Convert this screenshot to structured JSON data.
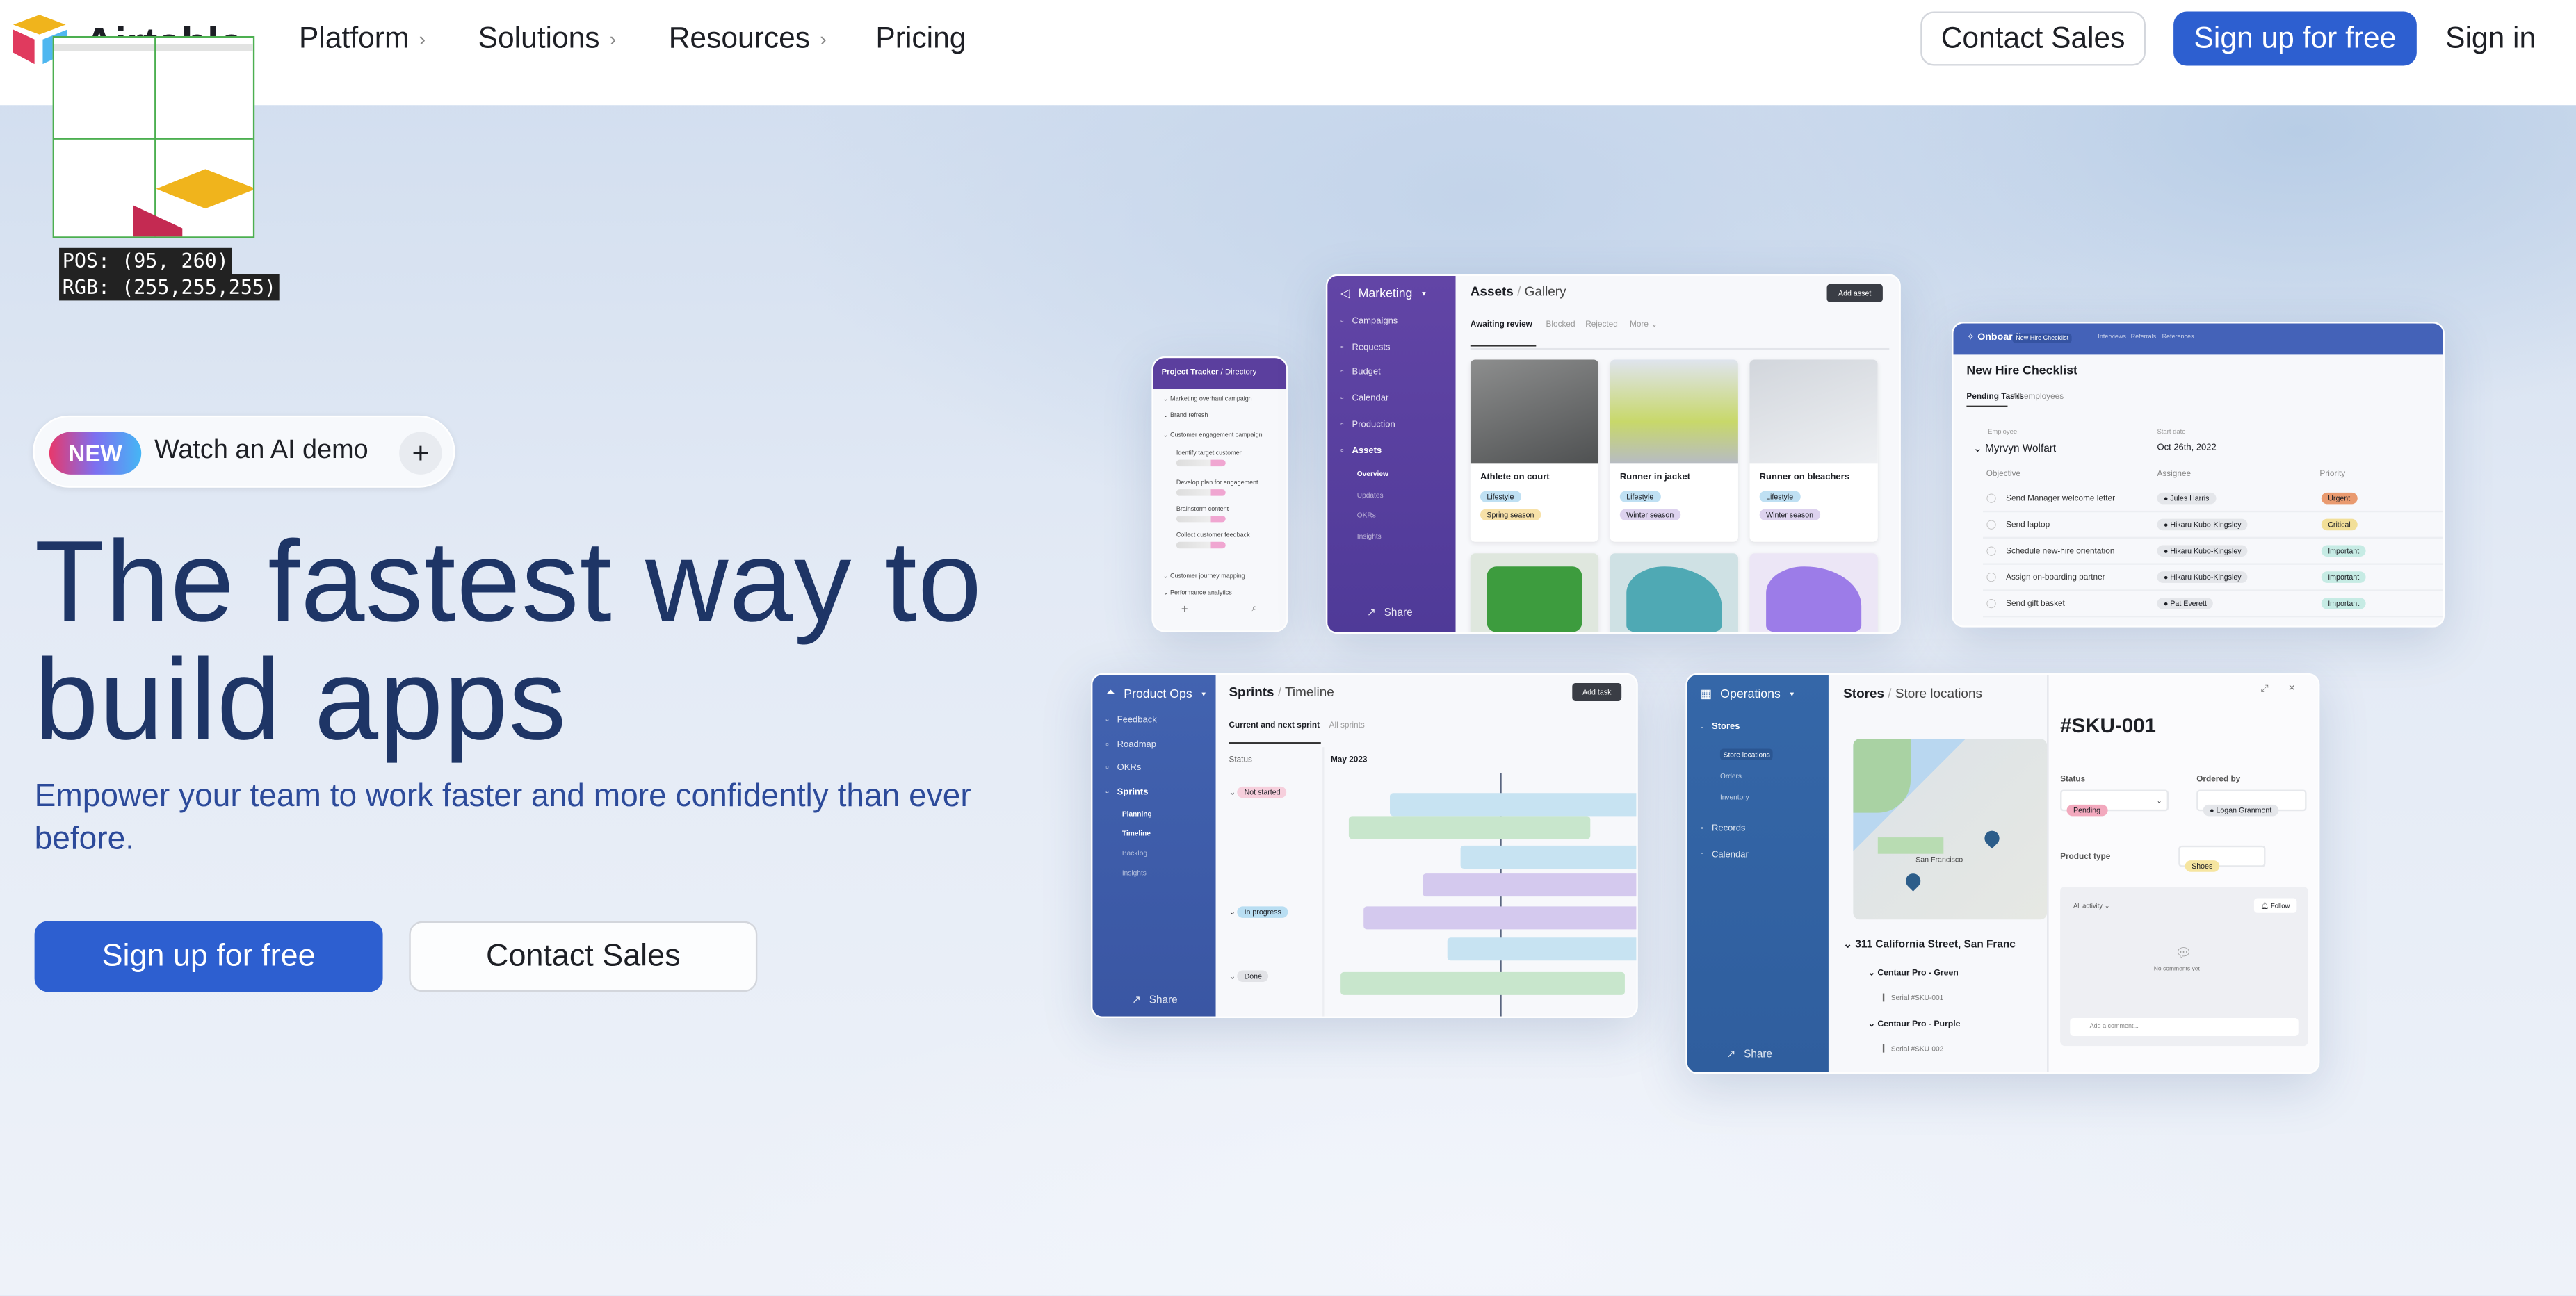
{
  "nav": {
    "brand": "Airtable",
    "items": [
      {
        "label": "Platform",
        "chevron": true
      },
      {
        "label": "Solutions",
        "chevron": true
      },
      {
        "label": "Resources",
        "chevron": true
      },
      {
        "label": "Pricing",
        "chevron": false
      }
    ],
    "contact_sales": "Contact Sales",
    "sign_up": "Sign up for free",
    "sign_in": "Sign in"
  },
  "overlay": {
    "pos": "POS: (95, 260)",
    "rgb": "RGB: (255,255,255)"
  },
  "hero": {
    "badge": "NEW",
    "demo": "Watch an AI demo",
    "title_line1": "The fastest way to",
    "title_line2": "build apps",
    "subtitle": "Empower your team to work faster and more confidently than ever before.",
    "cta_primary": "Sign up for free",
    "cta_secondary": "Contact Sales"
  },
  "colors": {
    "primary": "#2d5fd0",
    "heading": "#1e3566",
    "marketing": "#5b3f9e",
    "product_ops": "#3c5aa8",
    "operations": "#2f62a0",
    "onboarding": "#4462b8"
  },
  "tracker": {
    "title": "Project Tracker",
    "subtitle": "Directory",
    "items": [
      "Marketing overhaul campaign",
      "Brand refresh",
      "Customer engagement campaign",
      "Identify target customer",
      "Develop plan for engagement",
      "Brainstorm content",
      "Collect customer feedback",
      "Customer journey mapping",
      "Performance analytics"
    ]
  },
  "marketing": {
    "workspace": "Marketing",
    "nav": [
      "Campaigns",
      "Requests",
      "Budget",
      "Calendar",
      "Production",
      "Assets"
    ],
    "sub": [
      "Overview",
      "Updates",
      "OKRs",
      "Insights"
    ],
    "share": "Share",
    "title": "Assets",
    "view": "Gallery",
    "add": "Add asset",
    "tabs": [
      "Awaiting review",
      "Blocked",
      "Rejected",
      "More"
    ],
    "cards": [
      {
        "name": "Athlete on court",
        "tags": [
          "Lifestyle",
          "Spring season"
        ]
      },
      {
        "name": "Runner in jacket",
        "tags": [
          "Lifestyle",
          "Winter season"
        ]
      },
      {
        "name": "Runner on bleachers",
        "tags": [
          "Lifestyle",
          "Winter season"
        ]
      }
    ]
  },
  "onboarding": {
    "workspace": "Onboarding",
    "tabs": [
      "New Hire Checklist",
      "Interviews",
      "Referrals",
      "References"
    ],
    "title": "New Hire Checklist",
    "subtabs": [
      "Pending Tasks",
      "All employees"
    ],
    "employee_label": "Employee",
    "employee": "Myrvyn Wolfart",
    "start_label": "Start date",
    "start": "Oct 26th, 2022",
    "cols": [
      "Objective",
      "Assignee",
      "Priority"
    ],
    "rows": [
      {
        "objective": "Send Manager welcome letter",
        "assignee": "Jules Harris",
        "priority": "Urgent"
      },
      {
        "objective": "Send laptop",
        "assignee": "Hikaru Kubo-Kingsley",
        "priority": "Critical"
      },
      {
        "objective": "Schedule new-hire orientation",
        "assignee": "Hikaru Kubo-Kingsley",
        "priority": "Important"
      },
      {
        "objective": "Assign on-boarding partner",
        "assignee": "Hikaru Kubo-Kingsley",
        "priority": "Important"
      },
      {
        "objective": "Send gift basket",
        "assignee": "Pat Everett",
        "priority": "Important"
      }
    ]
  },
  "productops": {
    "workspace": "Product Ops",
    "nav": [
      "Feedback",
      "Roadmap",
      "OKRs",
      "Sprints"
    ],
    "sub": [
      "Planning",
      "Timeline",
      "Backlog",
      "Insights"
    ],
    "share": "Share",
    "title": "Sprints",
    "view": "Timeline",
    "add": "Add task",
    "tabs": [
      "Current and next sprint",
      "All sprints"
    ],
    "status_label": "Status",
    "month": "May 2023",
    "groups": [
      "Not started",
      "In progress",
      "Done"
    ]
  },
  "operations": {
    "workspace": "Operations",
    "nav": [
      "Stores",
      "Records",
      "Calendar"
    ],
    "sub": [
      "Store locations",
      "Orders",
      "Inventory"
    ],
    "share": "Share",
    "title": "Stores",
    "view": "Store locations",
    "map_label": "San Francisco",
    "address": "311 California Street, San Franc",
    "items": [
      {
        "name": "Centaur Pro - Green",
        "serial": "Serial #SKU-001"
      },
      {
        "name": "Centaur Pro - Purple",
        "serial": "Serial #SKU-002"
      }
    ],
    "detail": {
      "sku": "#SKU-001",
      "status_label": "Status",
      "status": "Pending",
      "ordered_label": "Ordered by",
      "ordered": "Logan Granmont",
      "product_label": "Product type",
      "product": "Shoes",
      "activity": "All activity",
      "follow": "Follow",
      "empty": "No comments yet",
      "comment_placeholder": "Add a comment..."
    }
  }
}
